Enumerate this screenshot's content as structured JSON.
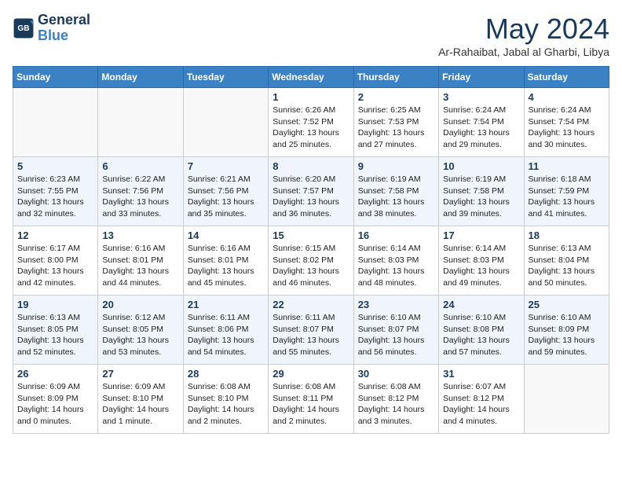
{
  "header": {
    "logo_line1": "General",
    "logo_line2": "Blue",
    "month_year": "May 2024",
    "location": "Ar-Rahaibat, Jabal al Gharbi, Libya"
  },
  "days_of_week": [
    "Sunday",
    "Monday",
    "Tuesday",
    "Wednesday",
    "Thursday",
    "Friday",
    "Saturday"
  ],
  "weeks": [
    [
      {
        "day": "",
        "info": ""
      },
      {
        "day": "",
        "info": ""
      },
      {
        "day": "",
        "info": ""
      },
      {
        "day": "1",
        "info": "Sunrise: 6:26 AM\nSunset: 7:52 PM\nDaylight: 13 hours\nand 25 minutes."
      },
      {
        "day": "2",
        "info": "Sunrise: 6:25 AM\nSunset: 7:53 PM\nDaylight: 13 hours\nand 27 minutes."
      },
      {
        "day": "3",
        "info": "Sunrise: 6:24 AM\nSunset: 7:54 PM\nDaylight: 13 hours\nand 29 minutes."
      },
      {
        "day": "4",
        "info": "Sunrise: 6:24 AM\nSunset: 7:54 PM\nDaylight: 13 hours\nand 30 minutes."
      }
    ],
    [
      {
        "day": "5",
        "info": "Sunrise: 6:23 AM\nSunset: 7:55 PM\nDaylight: 13 hours\nand 32 minutes."
      },
      {
        "day": "6",
        "info": "Sunrise: 6:22 AM\nSunset: 7:56 PM\nDaylight: 13 hours\nand 33 minutes."
      },
      {
        "day": "7",
        "info": "Sunrise: 6:21 AM\nSunset: 7:56 PM\nDaylight: 13 hours\nand 35 minutes."
      },
      {
        "day": "8",
        "info": "Sunrise: 6:20 AM\nSunset: 7:57 PM\nDaylight: 13 hours\nand 36 minutes."
      },
      {
        "day": "9",
        "info": "Sunrise: 6:19 AM\nSunset: 7:58 PM\nDaylight: 13 hours\nand 38 minutes."
      },
      {
        "day": "10",
        "info": "Sunrise: 6:19 AM\nSunset: 7:58 PM\nDaylight: 13 hours\nand 39 minutes."
      },
      {
        "day": "11",
        "info": "Sunrise: 6:18 AM\nSunset: 7:59 PM\nDaylight: 13 hours\nand 41 minutes."
      }
    ],
    [
      {
        "day": "12",
        "info": "Sunrise: 6:17 AM\nSunset: 8:00 PM\nDaylight: 13 hours\nand 42 minutes."
      },
      {
        "day": "13",
        "info": "Sunrise: 6:16 AM\nSunset: 8:01 PM\nDaylight: 13 hours\nand 44 minutes."
      },
      {
        "day": "14",
        "info": "Sunrise: 6:16 AM\nSunset: 8:01 PM\nDaylight: 13 hours\nand 45 minutes."
      },
      {
        "day": "15",
        "info": "Sunrise: 6:15 AM\nSunset: 8:02 PM\nDaylight: 13 hours\nand 46 minutes."
      },
      {
        "day": "16",
        "info": "Sunrise: 6:14 AM\nSunset: 8:03 PM\nDaylight: 13 hours\nand 48 minutes."
      },
      {
        "day": "17",
        "info": "Sunrise: 6:14 AM\nSunset: 8:03 PM\nDaylight: 13 hours\nand 49 minutes."
      },
      {
        "day": "18",
        "info": "Sunrise: 6:13 AM\nSunset: 8:04 PM\nDaylight: 13 hours\nand 50 minutes."
      }
    ],
    [
      {
        "day": "19",
        "info": "Sunrise: 6:13 AM\nSunset: 8:05 PM\nDaylight: 13 hours\nand 52 minutes."
      },
      {
        "day": "20",
        "info": "Sunrise: 6:12 AM\nSunset: 8:05 PM\nDaylight: 13 hours\nand 53 minutes."
      },
      {
        "day": "21",
        "info": "Sunrise: 6:11 AM\nSunset: 8:06 PM\nDaylight: 13 hours\nand 54 minutes."
      },
      {
        "day": "22",
        "info": "Sunrise: 6:11 AM\nSunset: 8:07 PM\nDaylight: 13 hours\nand 55 minutes."
      },
      {
        "day": "23",
        "info": "Sunrise: 6:10 AM\nSunset: 8:07 PM\nDaylight: 13 hours\nand 56 minutes."
      },
      {
        "day": "24",
        "info": "Sunrise: 6:10 AM\nSunset: 8:08 PM\nDaylight: 13 hours\nand 57 minutes."
      },
      {
        "day": "25",
        "info": "Sunrise: 6:10 AM\nSunset: 8:09 PM\nDaylight: 13 hours\nand 59 minutes."
      }
    ],
    [
      {
        "day": "26",
        "info": "Sunrise: 6:09 AM\nSunset: 8:09 PM\nDaylight: 14 hours\nand 0 minutes."
      },
      {
        "day": "27",
        "info": "Sunrise: 6:09 AM\nSunset: 8:10 PM\nDaylight: 14 hours\nand 1 minute."
      },
      {
        "day": "28",
        "info": "Sunrise: 6:08 AM\nSunset: 8:10 PM\nDaylight: 14 hours\nand 2 minutes."
      },
      {
        "day": "29",
        "info": "Sunrise: 6:08 AM\nSunset: 8:11 PM\nDaylight: 14 hours\nand 2 minutes."
      },
      {
        "day": "30",
        "info": "Sunrise: 6:08 AM\nSunset: 8:12 PM\nDaylight: 14 hours\nand 3 minutes."
      },
      {
        "day": "31",
        "info": "Sunrise: 6:07 AM\nSunset: 8:12 PM\nDaylight: 14 hours\nand 4 minutes."
      },
      {
        "day": "",
        "info": ""
      }
    ]
  ]
}
